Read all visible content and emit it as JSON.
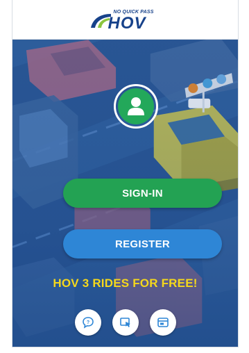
{
  "header": {
    "logo_tagline": "NO QUICK PASS",
    "logo_text": "HOV"
  },
  "colors": {
    "brand_blue": "#17428a",
    "signin_green": "#23a253",
    "register_blue": "#2e86d6",
    "promo_yellow": "#f5d81c",
    "background_blue": "#2c5b96"
  },
  "auth": {
    "avatar_icon": "user-icon",
    "signin_label": "SIGN-IN",
    "register_label": "REGISTER"
  },
  "promo": {
    "text": "HOV 3 RIDES FOR FREE!"
  },
  "footer_icons": [
    {
      "name": "chat-help-icon"
    },
    {
      "name": "cursor-window-icon"
    },
    {
      "name": "card-icon"
    }
  ]
}
